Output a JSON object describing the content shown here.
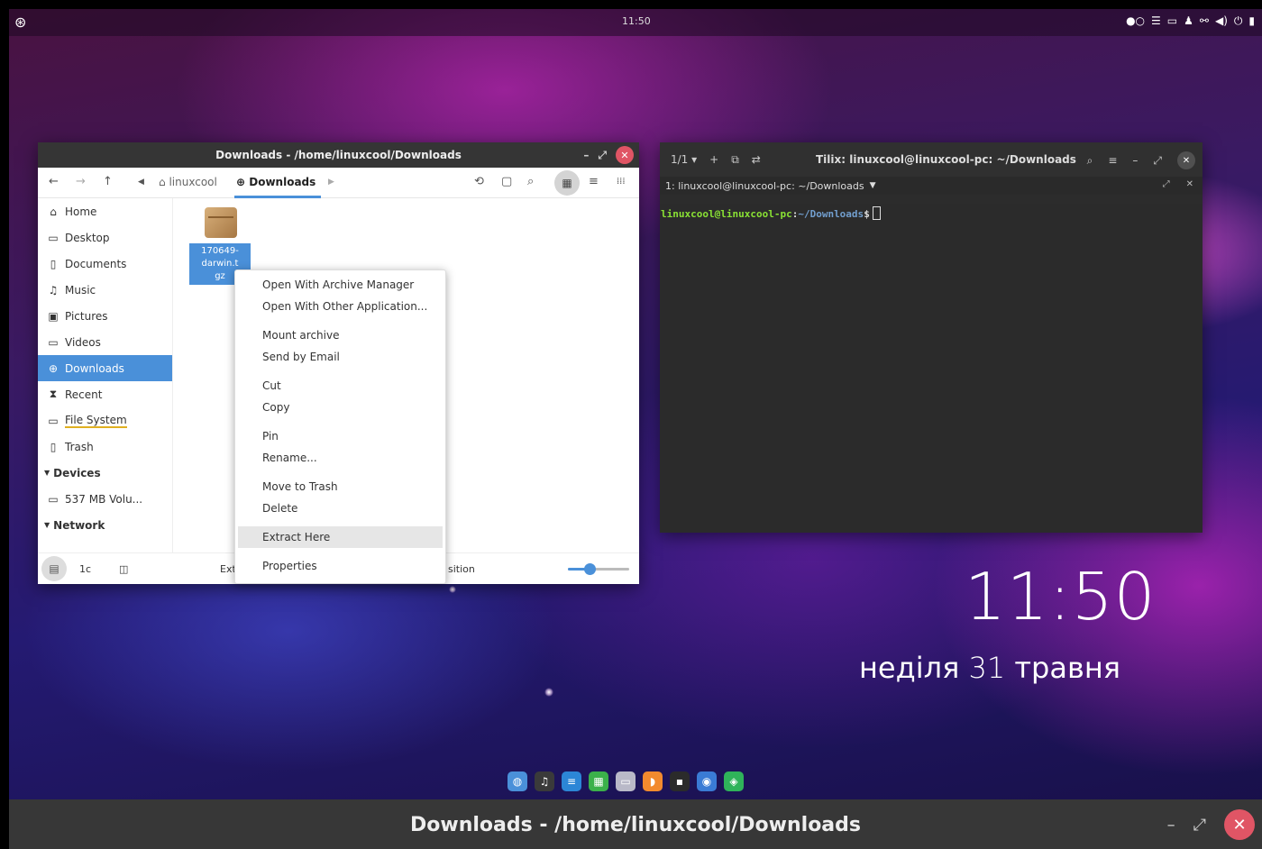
{
  "top_panel": {
    "logo_icon": "os-logo-icon",
    "clock": "11:50",
    "tray_icons": [
      "network-dots-icon",
      "menu-icon",
      "calendar-icon",
      "bell-icon",
      "link-icon",
      "volume-icon",
      "power-icon",
      "screen-icon"
    ]
  },
  "file_manager": {
    "title": "Downloads - /home/linuxcool/Downloads",
    "path": {
      "parent": "linuxcool",
      "current": "Downloads"
    },
    "sidebar": {
      "places": [
        {
          "label": "Home",
          "icon": "home-icon"
        },
        {
          "label": "Desktop",
          "icon": "desktop-icon"
        },
        {
          "label": "Documents",
          "icon": "documents-icon"
        },
        {
          "label": "Music",
          "icon": "music-icon"
        },
        {
          "label": "Pictures",
          "icon": "pictures-icon"
        },
        {
          "label": "Videos",
          "icon": "videos-icon"
        },
        {
          "label": "Downloads",
          "icon": "downloads-icon"
        },
        {
          "label": "Recent",
          "icon": "recent-icon"
        },
        {
          "label": "File System",
          "icon": "filesystem-icon"
        },
        {
          "label": "Trash",
          "icon": "trash-icon"
        }
      ],
      "devices_header": "Devices",
      "devices": [
        {
          "label": "537 MB Volu...",
          "icon": "drive-icon"
        }
      ],
      "network_header": "Network"
    },
    "file": {
      "name_lines": [
        "170649-",
        "darwin.t",
        "gz"
      ]
    },
    "status": {
      "left": "1c",
      "mid": "Ext",
      "right": "sition"
    },
    "zoom_fraction": 0.35
  },
  "context_menu": {
    "groups": [
      [
        "Open With Archive Manager",
        "Open With Other Application..."
      ],
      [
        "Mount archive",
        "Send by Email"
      ],
      [
        "Cut",
        "Copy"
      ],
      [
        "Pin",
        "Rename..."
      ],
      [
        "Move to Trash",
        "Delete"
      ],
      [
        "Extract Here"
      ],
      [
        "Properties"
      ]
    ],
    "highlighted": "Extract Here"
  },
  "terminal": {
    "tab_counter": "1/1",
    "title": "Tilix: linuxcool@linuxcool-pc: ~/Downloads",
    "session": "1: linuxcool@linuxcool-pc: ~/Downloads",
    "prompt_user": "linuxcool@linuxcool-pc",
    "prompt_sep": ":",
    "prompt_path": "~/Downloads",
    "prompt_sign": "$"
  },
  "desktop_clock": {
    "time": "11:50",
    "day": "неділя",
    "date_num": "31",
    "month": "травня"
  },
  "dock": [
    {
      "icon": "browser-icon",
      "color": "#4a90d9"
    },
    {
      "icon": "music-player-icon",
      "color": "#3a3a3a"
    },
    {
      "icon": "text-editor-icon",
      "color": "#2c86d6"
    },
    {
      "icon": "spreadsheet-icon",
      "color": "#3bb14a"
    },
    {
      "icon": "files-icon",
      "color": "#b9b9c8"
    },
    {
      "icon": "software-center-icon",
      "color": "#f28a2e"
    },
    {
      "icon": "terminal-icon",
      "color": "#2b2b2b"
    },
    {
      "icon": "screenshot-icon",
      "color": "#3a7bd5"
    },
    {
      "icon": "vpn-icon",
      "color": "#2fb35a"
    }
  ],
  "bottom_bar": {
    "title": "Downloads - /home/linuxcool/Downloads"
  }
}
